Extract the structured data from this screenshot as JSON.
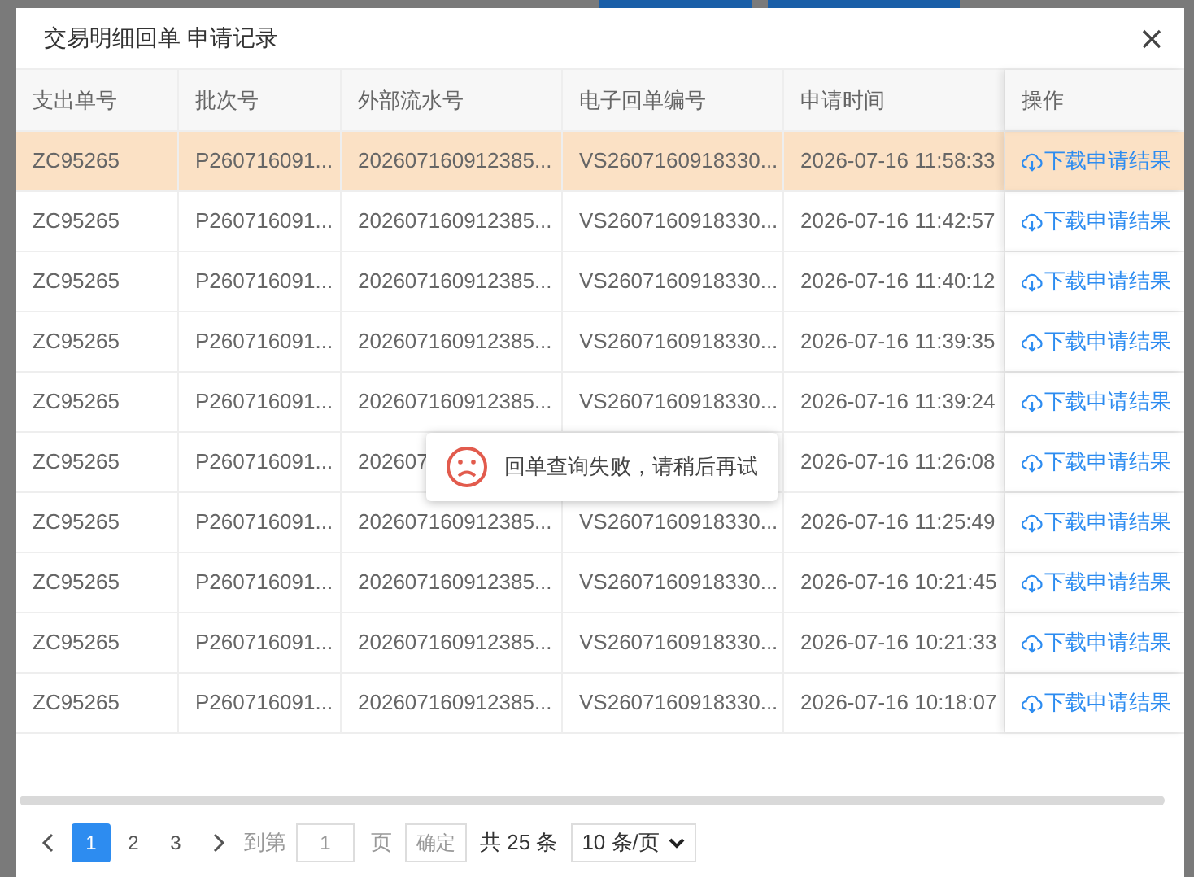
{
  "dialog": {
    "title": "交易明细回单 申请记录"
  },
  "table": {
    "columns": [
      "支出单号",
      "批次号",
      "外部流水号",
      "电子回单编号",
      "申请时间",
      "操作"
    ],
    "rows": [
      {
        "selected": true,
        "cells": [
          "ZC95265",
          "P260716091...",
          "202607160912385...",
          "VS2607160918330...",
          "2026-07-16 11:58:33"
        ],
        "action": "下载申请结果"
      },
      {
        "selected": false,
        "cells": [
          "ZC95265",
          "P260716091...",
          "202607160912385...",
          "VS2607160918330...",
          "2026-07-16 11:42:57"
        ],
        "action": "下载申请结果"
      },
      {
        "selected": false,
        "cells": [
          "ZC95265",
          "P260716091...",
          "202607160912385...",
          "VS2607160918330...",
          "2026-07-16 11:40:12"
        ],
        "action": "下载申请结果"
      },
      {
        "selected": false,
        "cells": [
          "ZC95265",
          "P260716091...",
          "202607160912385...",
          "VS2607160918330...",
          "2026-07-16 11:39:35"
        ],
        "action": "下载申请结果"
      },
      {
        "selected": false,
        "cells": [
          "ZC95265",
          "P260716091...",
          "202607160912385...",
          "VS2607160918330...",
          "2026-07-16 11:39:24"
        ],
        "action": "下载申请结果"
      },
      {
        "selected": false,
        "cells": [
          "ZC95265",
          "P260716091...",
          "202607",
          null,
          "2026-07-16 11:26:08"
        ],
        "action": "下载申请结果"
      },
      {
        "selected": false,
        "cells": [
          "ZC95265",
          "P260716091...",
          "202607160912385...",
          "VS2607160918330...",
          "2026-07-16 11:25:49"
        ],
        "action": "下载申请结果"
      },
      {
        "selected": false,
        "cells": [
          "ZC95265",
          "P260716091...",
          "202607160912385...",
          "VS2607160918330...",
          "2026-07-16 10:21:45"
        ],
        "action": "下载申请结果"
      },
      {
        "selected": false,
        "cells": [
          "ZC95265",
          "P260716091...",
          "202607160912385...",
          "VS2607160918330...",
          "2026-07-16 10:21:33"
        ],
        "action": "下载申请结果"
      },
      {
        "selected": false,
        "cells": [
          "ZC95265",
          "P260716091...",
          "202607160912385...",
          "VS2607160918330...",
          "2026-07-16 10:18:07"
        ],
        "action": "下载申请结果"
      }
    ]
  },
  "toast": {
    "message": "回单查询失败，请稍后再试"
  },
  "pagination": {
    "pages": [
      {
        "label": "1",
        "selected": true
      },
      {
        "label": "2",
        "selected": false
      },
      {
        "label": "3",
        "selected": false
      }
    ],
    "goto_label": "到第",
    "page_input": "1",
    "page_unit": "页",
    "confirm": "确定",
    "total": "共 25 条",
    "page_size": "10 条/页"
  }
}
